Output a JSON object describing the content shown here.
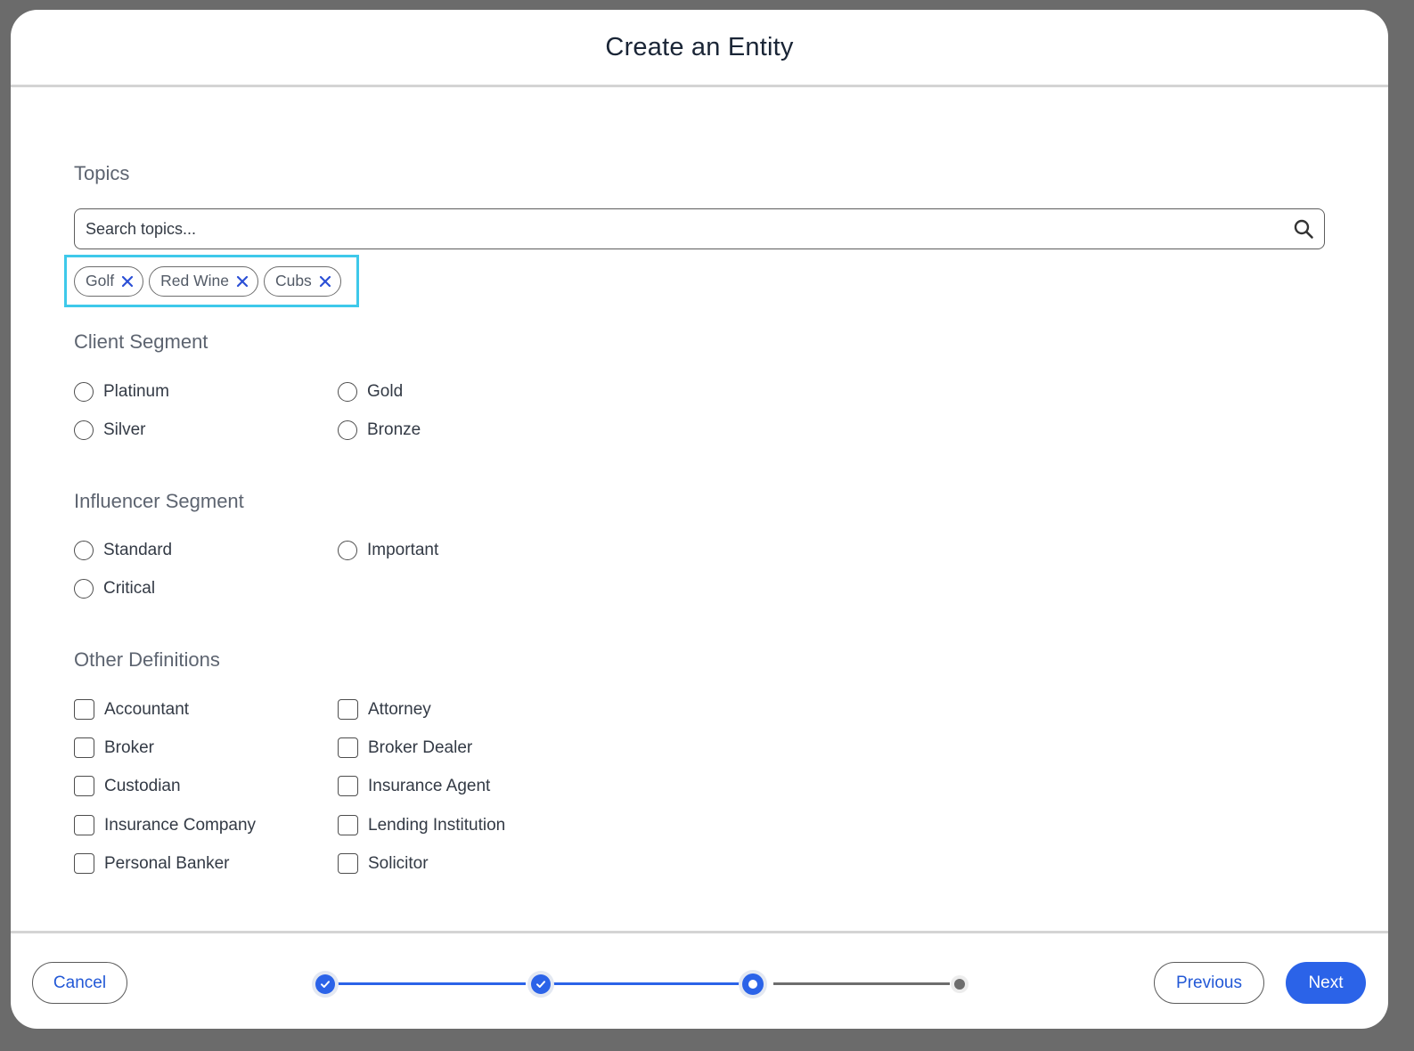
{
  "modal": {
    "title": "Create an Entity"
  },
  "topics": {
    "label": "Topics",
    "search_placeholder": "Search topics...",
    "search_icon": "search-icon",
    "chips": [
      "Golf",
      "Red Wine",
      "Cubs"
    ],
    "chip_remove_icon": "close-icon"
  },
  "client_segment": {
    "label": "Client Segment",
    "options": [
      "Platinum",
      "Gold",
      "Silver",
      "Bronze"
    ]
  },
  "influencer_segment": {
    "label": "Influencer Segment",
    "options": [
      "Standard",
      "Important",
      "Critical"
    ]
  },
  "other_definitions": {
    "label": "Other Definitions",
    "options": [
      "Accountant",
      "Attorney",
      "Broker",
      "Broker Dealer",
      "Custodian",
      "Insurance Agent",
      "Insurance Company",
      "Lending Institution",
      "Personal Banker",
      "Solicitor"
    ]
  },
  "footer": {
    "cancel_label": "Cancel",
    "previous_label": "Previous",
    "next_label": "Next",
    "stepper": {
      "total_steps": 4,
      "current_step": 3,
      "completed_steps": 2
    }
  },
  "colors": {
    "accent": "#2b63e8",
    "highlight_border": "#3ec9ea",
    "title_text": "#1a2536",
    "label_text": "#5d6470"
  }
}
